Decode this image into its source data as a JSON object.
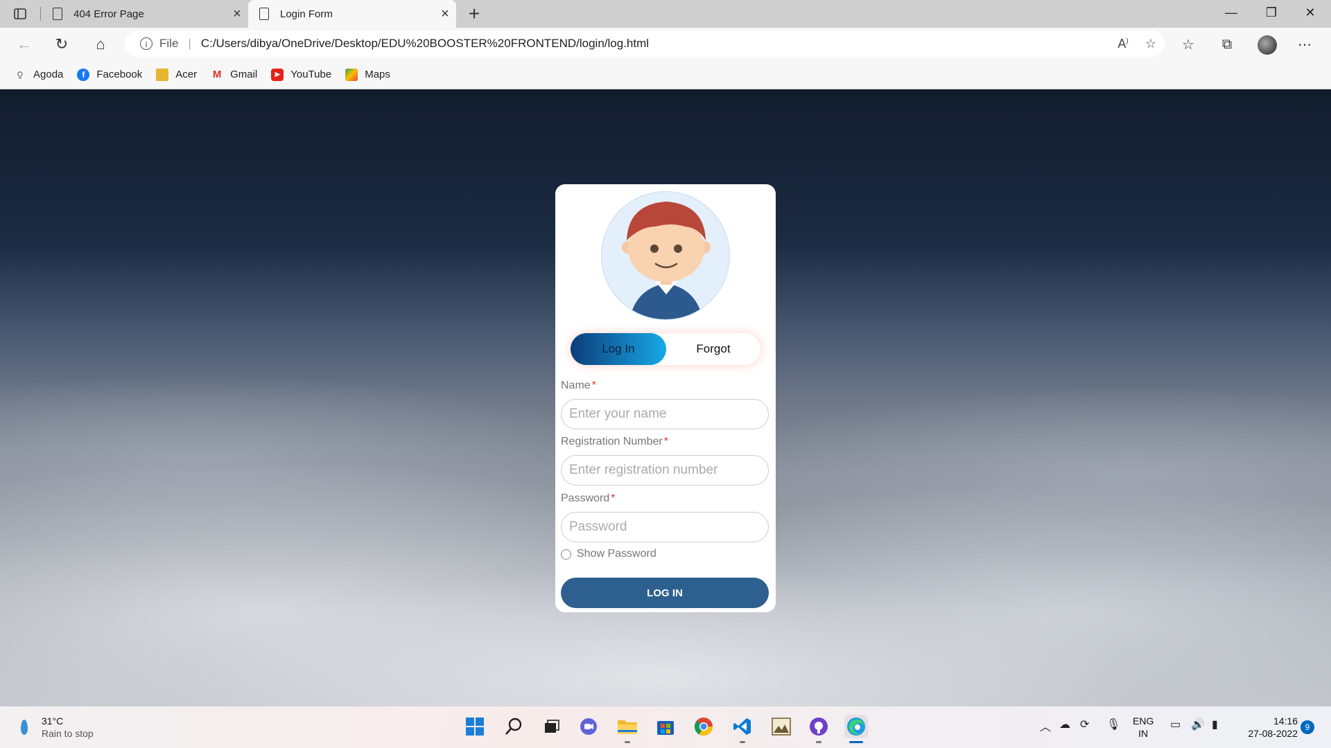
{
  "browser": {
    "tabs": [
      {
        "title": "404 Error Page",
        "active": false
      },
      {
        "title": "Login Form",
        "active": true
      }
    ],
    "address": {
      "scheme": "File",
      "url": "C:/Users/dibya/OneDrive/Desktop/EDU%20BOOSTER%20FRONTEND/login/log.html"
    },
    "bookmarks": [
      {
        "label": "Agoda",
        "icon": "agoda-icon",
        "color": "#333333"
      },
      {
        "label": "Facebook",
        "icon": "facebook-icon",
        "color": "#1877f2"
      },
      {
        "label": "Acer",
        "icon": "folder-icon",
        "color": "#e8b530"
      },
      {
        "label": "Gmail",
        "icon": "gmail-icon",
        "color": "#d93025"
      },
      {
        "label": "YouTube",
        "icon": "youtube-icon",
        "color": "#e62117"
      },
      {
        "label": "Maps",
        "icon": "maps-icon",
        "color": "#34a853"
      }
    ]
  },
  "login": {
    "tab_login": "Log In",
    "tab_forgot": "Forgot",
    "fields": [
      {
        "label": "Name",
        "required": "*",
        "placeholder": "Enter your name"
      },
      {
        "label": "Registration Number",
        "required": "*",
        "placeholder": "Enter registration number"
      },
      {
        "label": "Password",
        "required": "*",
        "placeholder": "Password"
      }
    ],
    "show_password": "Show Password",
    "submit": "LOG IN",
    "accent": "#2d5f8f"
  },
  "taskbar": {
    "weather": {
      "temp": "31°C",
      "status": "Rain to stop"
    },
    "apps": [
      "start-icon",
      "search-icon",
      "task-view-icon",
      "chat-icon",
      "file-explorer-icon",
      "store-icon",
      "chrome-icon",
      "vscode-icon",
      "image-viewer-icon",
      "github-icon",
      "edge-icon"
    ],
    "lang": {
      "line1": "ENG",
      "line2": "IN"
    },
    "time": "14:16",
    "date": "27-08-2022",
    "notifications": "9"
  }
}
